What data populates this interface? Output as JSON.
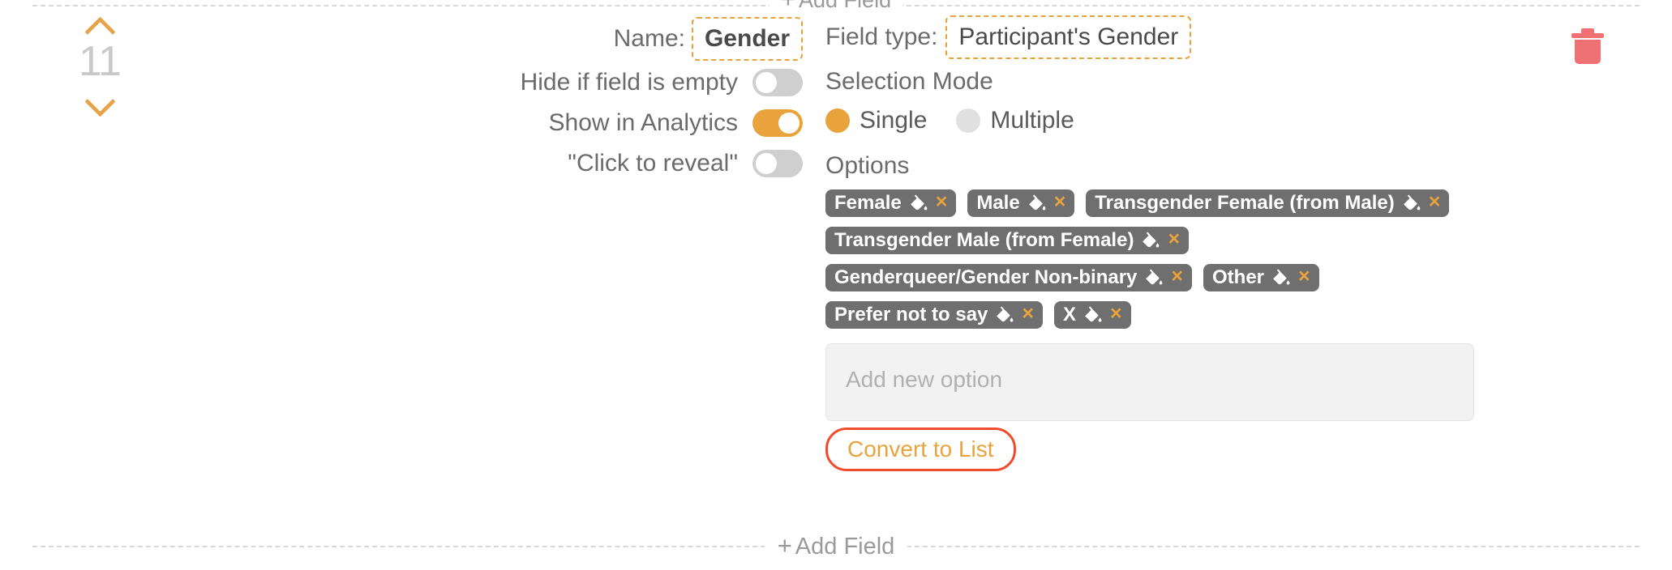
{
  "top_add_field": {
    "label": "Add Field",
    "plus": "+"
  },
  "order_control": {
    "number": "11",
    "move_up_icon": "chevron-up-icon",
    "move_down_icon": "chevron-down-icon"
  },
  "delete": {
    "icon": "trash-icon"
  },
  "field": {
    "name_label": "Name:",
    "name_value": "Gender",
    "type_label": "Field type:",
    "type_value": "Participant's Gender"
  },
  "toggles": [
    {
      "label": "Hide if field is empty",
      "state": "off"
    },
    {
      "label": "Show in Analytics",
      "state": "on"
    },
    {
      "label": "\"Click to reveal\"",
      "state": "off"
    }
  ],
  "selection_mode": {
    "title": "Selection Mode",
    "options": [
      {
        "label": "Single",
        "selected": true
      },
      {
        "label": "Multiple",
        "selected": false
      }
    ]
  },
  "options": {
    "title": "Options",
    "chips": [
      {
        "label": "Female"
      },
      {
        "label": "Male"
      },
      {
        "label": "Transgender Female (from Male)"
      },
      {
        "label": "Transgender Male (from Female)"
      },
      {
        "label": "Genderqueer/Gender Non-binary"
      },
      {
        "label": "Other"
      },
      {
        "label": "Prefer not to say"
      },
      {
        "label": "X"
      }
    ],
    "chip_fill_icon": "paint-bucket-icon",
    "chip_remove_icon": "close-icon",
    "chip_remove_glyph": "×",
    "add_new_placeholder": "Add new option",
    "add_new_value": "",
    "convert_label": "Convert to List"
  },
  "bottom_add_field": {
    "label": "Add Field",
    "plus": "+"
  },
  "colors": {
    "accent_orange": "#e8a33d",
    "chip_gray": "#6f6f6f",
    "delete_red": "#ef7173",
    "convert_border_red": "#ef4b2d",
    "toggle_off_gray": "#cfcfcf",
    "text_gray": "#6b6b6b"
  }
}
